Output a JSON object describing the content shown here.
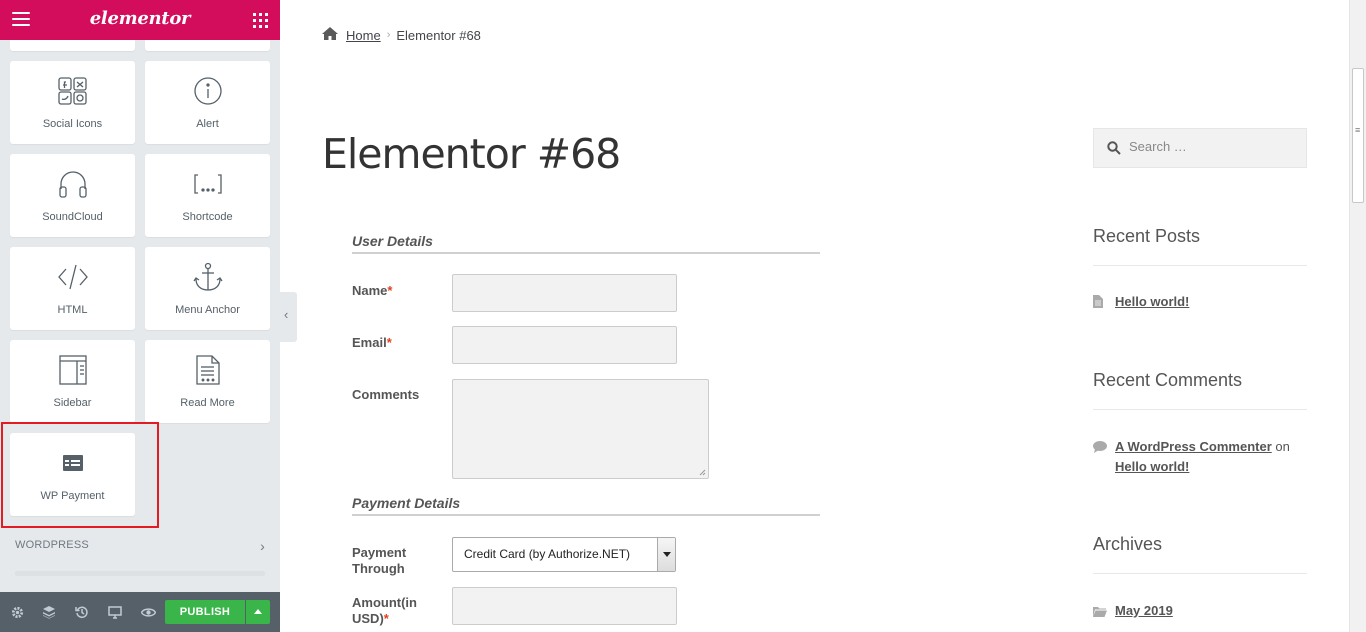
{
  "panel": {
    "brand": "elementor",
    "widgets": [
      {
        "label": "Social Icons",
        "icon": "social-icons-icon"
      },
      {
        "label": "Alert",
        "icon": "alert-icon"
      },
      {
        "label": "SoundCloud",
        "icon": "headphones-icon"
      },
      {
        "label": "Shortcode",
        "icon": "shortcode-icon"
      },
      {
        "label": "HTML",
        "icon": "code-icon"
      },
      {
        "label": "Menu Anchor",
        "icon": "anchor-icon"
      },
      {
        "label": "Sidebar",
        "icon": "sidebar-icon"
      },
      {
        "label": "Read More",
        "icon": "read-more-icon"
      },
      {
        "label": "WP Payment",
        "icon": "payment-form-icon"
      }
    ],
    "section_wordpress": "WORDPRESS",
    "publish_label": "PUBLISH",
    "highlight_color": "#e31b23",
    "brand_color": "#d30c5c",
    "publish_color": "#39b54a"
  },
  "breadcrumb": {
    "home": "Home",
    "separator": "›",
    "current": "Elementor #68"
  },
  "page_title": "Elementor #68",
  "form": {
    "section_user": "User Details",
    "label_name": "Name",
    "label_email": "Email",
    "label_comments": "Comments",
    "required_mark": "*",
    "section_payment": "Payment Details",
    "label_payment_line1": "Payment",
    "label_payment_line2": "Through",
    "payment_selected": "Credit Card (by Authorize.NET)",
    "label_amount_line1": "Amount(in",
    "label_amount_line2": "USD)"
  },
  "sidebar": {
    "search_placeholder": "Search …",
    "recent_posts_title": "Recent Posts",
    "recent_post_1": "Hello world!",
    "recent_comments_title": "Recent Comments",
    "commenter": "A WordPress Commenter",
    "on_word": "on",
    "comment_post": "Hello world!",
    "archives_title": "Archives",
    "archive_1": "May 2019"
  }
}
